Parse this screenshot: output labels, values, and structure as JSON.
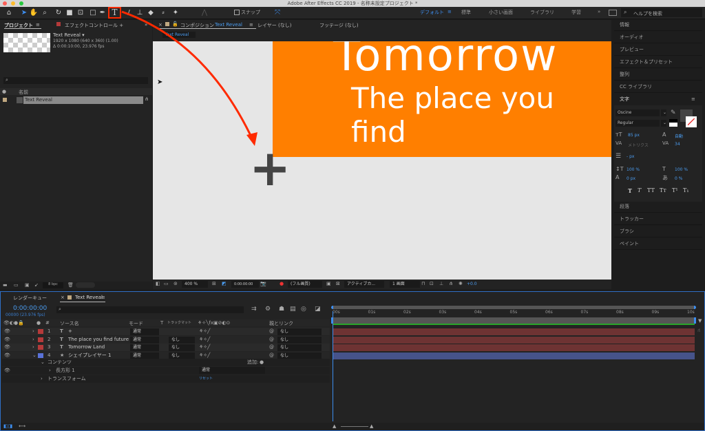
{
  "window": {
    "title": "Adobe After Effects CC 2019 - 名称未設定プロジェクト *"
  },
  "toolbar": {
    "snap_label": "スナップ",
    "workspaces": [
      "デフォルト",
      "標準",
      "小さい画面",
      "ライブラリ",
      "学習"
    ],
    "more": "»",
    "help_placeholder": "ヘルプを検索",
    "highlight_color": "#ff2a00"
  },
  "project": {
    "tab": "プロジェクト",
    "effects_tab": "エフェクトコントロール +",
    "more": "»",
    "comp_name": "Text Reveal ▾",
    "comp_size": "1920 x 1080  (640 x 360) (1.00)",
    "comp_duration": "Δ 0:00:10:00, 23.976 fps",
    "col_name": "名前",
    "item": "Text Reveal",
    "bpc": "8 bpc"
  },
  "comp": {
    "tabs": [
      "コンポジション",
      "レイヤー (なし)",
      "フッテージ (なし)"
    ],
    "comp_tab_name": "Text Reveal",
    "breadcrumb": "Text Reveal",
    "canvas_text1": "Tomorrow",
    "canvas_text2": "The place you find",
    "orange": "#ff7f00",
    "zoom": "400 %",
    "timecode": "0:00:00:00",
    "quality": "(フル画質)",
    "camera": "アクティブカ...",
    "views": "1 画面",
    "exposure": "+0.0"
  },
  "right": {
    "items": [
      "情報",
      "オーディオ",
      "プレビュー",
      "エフェクト＆プリセット",
      "整列",
      "CC ライブラリ"
    ],
    "char_title": "文字",
    "font": "Oscine",
    "style": "Regular",
    "size": "85 px",
    "leading": "自動",
    "kerning": "メトリクス",
    "tracking": "34",
    "stroke": "- px",
    "vscale": "100 %",
    "hscale": "100 %",
    "baseline": "0 px",
    "tsume": "0 %",
    "type_buttons": [
      "T",
      "T",
      "TT",
      "Tт",
      "T¹",
      "T₁"
    ],
    "items2": [
      "段落",
      "トラッカー",
      "ブラシ",
      "ペイント"
    ]
  },
  "timeline": {
    "render_tab": "レンダーキュー",
    "comp_tab": "Text Reveal",
    "timecode": "0:00:00:00",
    "fps": "00000 (23.976 fps)",
    "headers": {
      "source": "ソース名",
      "mode": "モード",
      "t": "T",
      "trackmatte": "トラックマット",
      "parent": "親とリンク"
    },
    "layers": [
      {
        "num": "1",
        "type": "T",
        "name": "+",
        "mode": "通常",
        "matte": "",
        "parent": "なし",
        "color": "#b53a3a"
      },
      {
        "num": "2",
        "type": "T",
        "name": "The place you find future",
        "mode": "通常",
        "matte": "なし",
        "parent": "なし",
        "color": "#b53a3a"
      },
      {
        "num": "3",
        "type": "T",
        "name": "Tomorrow Land",
        "mode": "通常",
        "matte": "なし",
        "parent": "なし",
        "color": "#b53a3a"
      },
      {
        "num": "4",
        "type": "★",
        "name": "シェイプレイヤー 1",
        "mode": "通常",
        "matte": "なし",
        "parent": "なし",
        "color": "#5a72d8"
      }
    ],
    "contents": "コンテンツ",
    "add": "追加:",
    "rect": "長方形 1",
    "rect_mode": "通常",
    "transform": "トランスフォーム",
    "reset": "リセット",
    "ruler": [
      "00s",
      "01s",
      "02s",
      "03s",
      "04s",
      "05s",
      "06s",
      "07s",
      "08s",
      "09s",
      "10s"
    ]
  }
}
